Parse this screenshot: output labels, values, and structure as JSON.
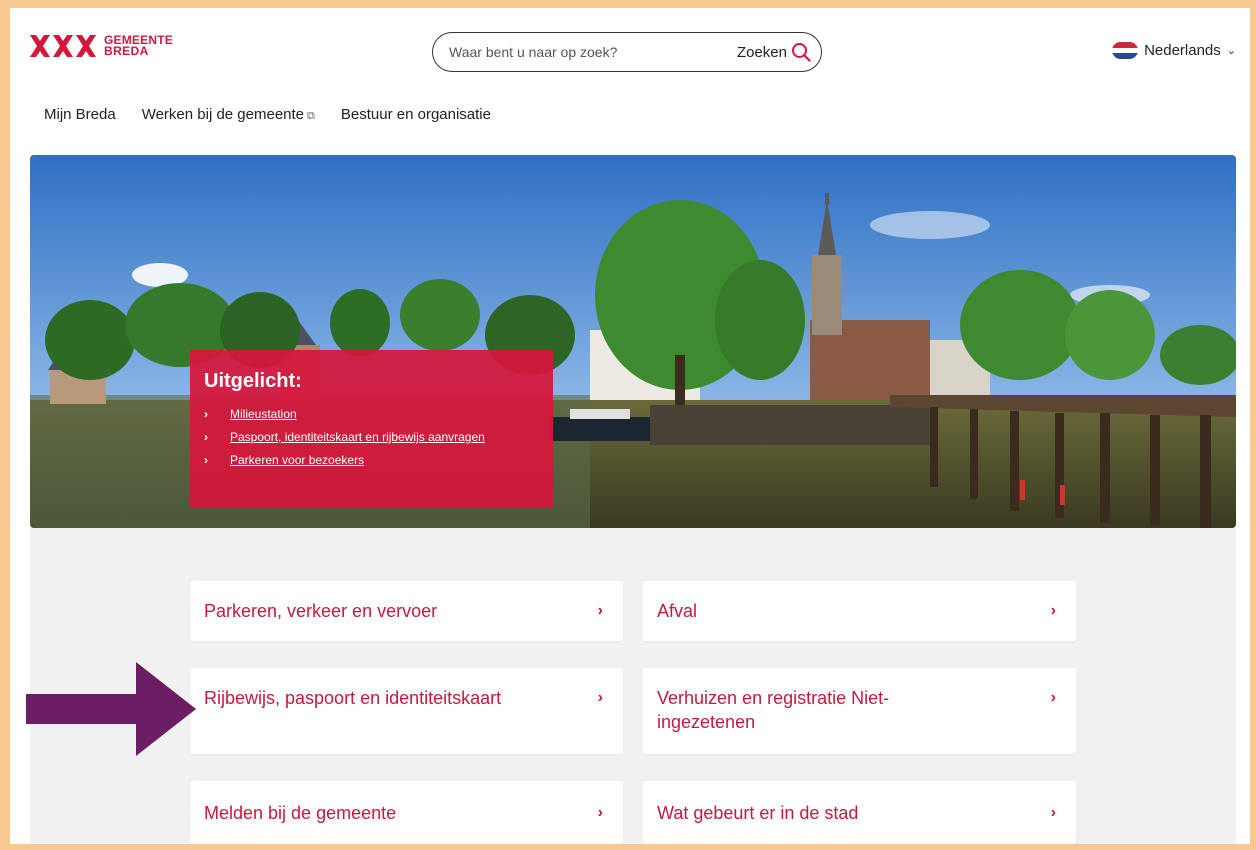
{
  "header": {
    "logo_line1": "GEMEENTE",
    "logo_line2": "BREDA",
    "search_placeholder": "Waar bent u naar op zoek?",
    "search_button": "Zoeken",
    "language": "Nederlands"
  },
  "nav": {
    "items": [
      {
        "label": "Mijn Breda"
      },
      {
        "label": "Werken bij de gemeente"
      },
      {
        "label": "Bestuur en organisatie"
      }
    ]
  },
  "featured": {
    "title": "Uitgelicht:",
    "links": [
      {
        "label": "Milieustation"
      },
      {
        "label": "Paspoort, identiteitskaart en rijbewijs aanvragen"
      },
      {
        "label": "Parkeren voor bezoekers"
      }
    ]
  },
  "categories": [
    {
      "label": "Parkeren, verkeer en vervoer"
    },
    {
      "label": "Afval"
    },
    {
      "label": "Rijbewijs, paspoort en identiteitskaart"
    },
    {
      "label": "Verhuizen en registratie Niet-ingezetenen"
    },
    {
      "label": "Melden bij de gemeente"
    },
    {
      "label": "Wat gebeurt er in de stad"
    }
  ],
  "colors": {
    "brand_red": "#d3183b",
    "frame": "#f5c98f",
    "arrow": "#6b1e63"
  },
  "icons": {
    "search": "magnifier-icon",
    "chevron": "chevron-right-icon",
    "external": "external-link-icon"
  }
}
